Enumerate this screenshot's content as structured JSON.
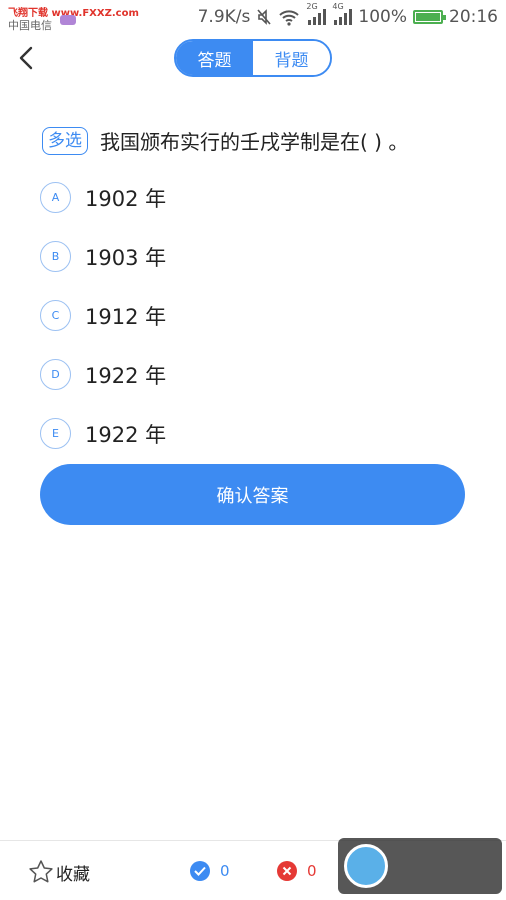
{
  "status_bar": {
    "watermark_text": "飞翔下载 www.FXXZ.com",
    "carrier": "中国电信",
    "speed": "7.9K/s",
    "network_2g": "2G",
    "network_4g": "4G",
    "battery": "100%",
    "time": "20:16"
  },
  "header": {
    "tabs": [
      {
        "label": "答题",
        "active": true
      },
      {
        "label": "背题",
        "active": false
      }
    ]
  },
  "question": {
    "type_badge": "多选",
    "text": "我国颁布实行的壬戌学制是在( ) 。",
    "options": [
      {
        "letter": "A",
        "text": "1902 年"
      },
      {
        "letter": "B",
        "text": "1903 年"
      },
      {
        "letter": "C",
        "text": "1912 年"
      },
      {
        "letter": "D",
        "text": "1922 年"
      },
      {
        "letter": "E",
        "text": "1922 年"
      }
    ]
  },
  "confirm_label": "确认答案",
  "bottom_bar": {
    "favorite_label": "收藏",
    "correct_count": "0",
    "wrong_count": "0"
  },
  "colors": {
    "accent": "#3d8bf2",
    "error": "#e53935"
  }
}
